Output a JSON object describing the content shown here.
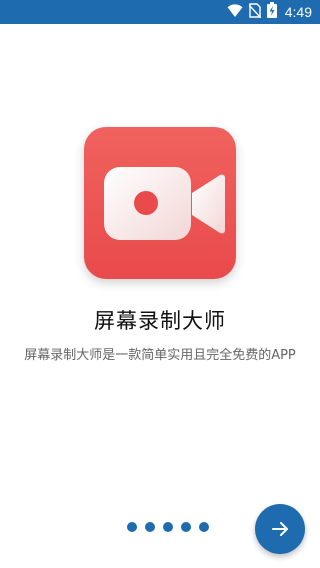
{
  "colors": {
    "status_bar": "#1e6bb0",
    "accent": "#1e6bb0",
    "icon_background": "#ec5654",
    "title_text": "#111111",
    "description_text": "#666666"
  },
  "status_bar": {
    "icons": [
      "wifi-icon",
      "no-sim-icon",
      "battery-charging-icon"
    ],
    "time": "4:49"
  },
  "app": {
    "icon": "video-camera-icon",
    "title": "屏幕录制大师",
    "description": "屏幕录制大师是一款简单实用且完全免费的APP"
  },
  "pager": {
    "total_pages": 5
  },
  "next_button": {
    "icon": "arrow-right-icon"
  }
}
